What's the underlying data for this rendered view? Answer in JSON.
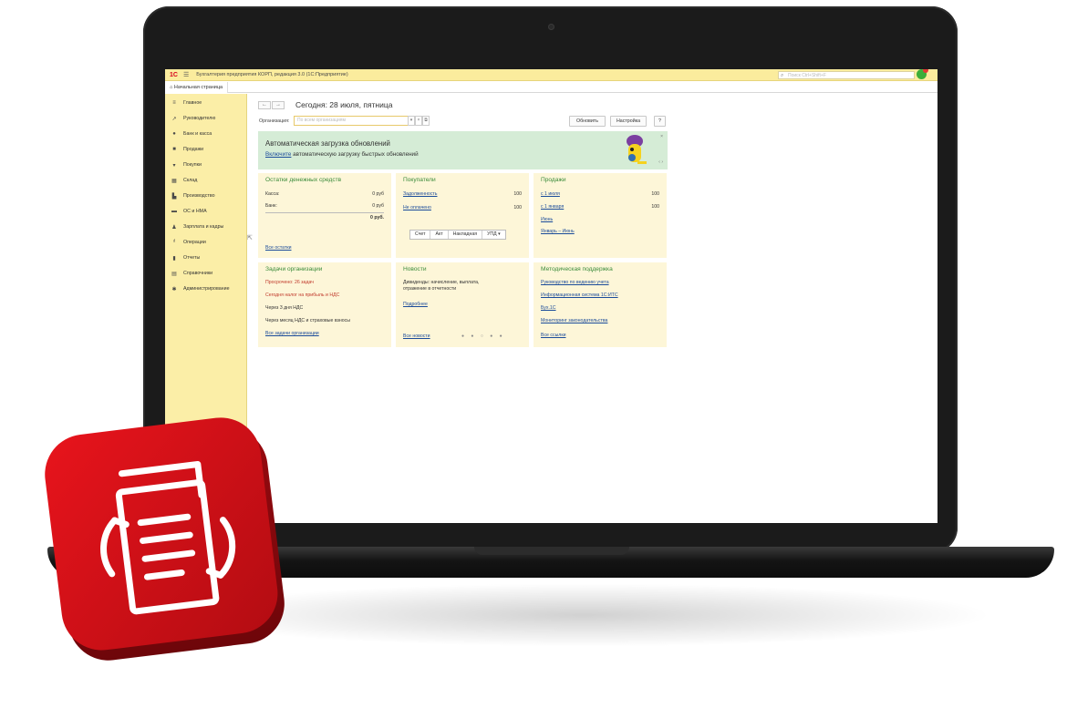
{
  "window": {
    "logo": "1С",
    "app_title": "Бухгалтерия предприятия КОРП, редакция 3.0  (1С:Предприятие)",
    "search_placeholder": "Поиск Ctrl+Shift+F"
  },
  "tabs": [
    {
      "label": "Начальная страница"
    }
  ],
  "sidebar": {
    "items": [
      {
        "label": "Главное",
        "icon": "menu-lines-icon"
      },
      {
        "label": "Руководителю",
        "icon": "trend-icon"
      },
      {
        "label": "Банк и касса",
        "icon": "coin-icon"
      },
      {
        "label": "Продажи",
        "icon": "bag-icon"
      },
      {
        "label": "Покупки",
        "icon": "cart-icon"
      },
      {
        "label": "Склад",
        "icon": "warehouse-icon"
      },
      {
        "label": "Производство",
        "icon": "factory-icon"
      },
      {
        "label": "ОС и НМА",
        "icon": "truck-icon"
      },
      {
        "label": "Зарплата и кадры",
        "icon": "person-icon"
      },
      {
        "label": "Операции",
        "icon": "operations-icon"
      },
      {
        "label": "Отчеты",
        "icon": "bar-chart-icon"
      },
      {
        "label": "Справочники",
        "icon": "book-icon"
      },
      {
        "label": "Администрирование",
        "icon": "gear-icon"
      }
    ]
  },
  "header": {
    "title": "Сегодня: 28 июля, пятница",
    "org_label": "Организация:",
    "org_placeholder": "По всем организациям",
    "refresh_label": "Обновить",
    "settings_label": "Настройка",
    "help_label": "?"
  },
  "banner": {
    "title": "Автоматическая загрузка обновлений",
    "link_text": "Включите",
    "text": " автоматическую загрузку быстрых обновлений",
    "close": "×",
    "pager": "‹  ›"
  },
  "cards": {
    "cash": {
      "title": "Остатки денежных средств",
      "rows": [
        {
          "label": "Касса:",
          "value": "0 руб"
        },
        {
          "label": "Банк:",
          "value": "0 руб"
        }
      ],
      "total": "0 руб.",
      "link": "Все остатки"
    },
    "buyers": {
      "title": "Покупатели",
      "rows": [
        {
          "label": "Задолженность",
          "value": "100"
        },
        {
          "label": "Не оплачено",
          "value": "100"
        }
      ],
      "buttons": [
        "Счет",
        "Акт",
        "Накладная",
        "УПД ▾"
      ]
    },
    "sales": {
      "title": "Продажи",
      "rows": [
        {
          "label": "с 1 июля",
          "value": "100"
        },
        {
          "label": "с 1 января",
          "value": "100"
        }
      ],
      "links": [
        "Июнь",
        "Январь – Июнь"
      ]
    },
    "tasks": {
      "title": "Задачи организации",
      "lines": [
        "Просрочено: 26 задач",
        "Сегодня налог на прибыль и НДС",
        "Через 3 дня НДС",
        "Через месяц НДС и страховые взносы"
      ],
      "link": "Все задачи организации"
    },
    "news": {
      "title": "Новости",
      "text_line1": "Дивиденды: начисление, выплата,",
      "text_line2": "отражение в отчетности",
      "more": "Подробнее",
      "all": "Все новости",
      "dots": "● ● ○ ● ●"
    },
    "support": {
      "title": "Методическая поддержка",
      "links": [
        "Руководство по ведению учета",
        "Информационная система 1С:ИТС",
        "Бух.1С",
        "Мониторинг законодательства"
      ],
      "all": "Все ссылки"
    }
  },
  "colors": {
    "titlebar": "#fbec9d",
    "sidebar": "#fbeea7",
    "card": "#fdf6d8",
    "banner": "#d5ecd6",
    "accent_green": "#3a8b3a",
    "app_icon_red": "#d3121b"
  },
  "app_icon": {
    "icon": "document-sync-icon"
  }
}
